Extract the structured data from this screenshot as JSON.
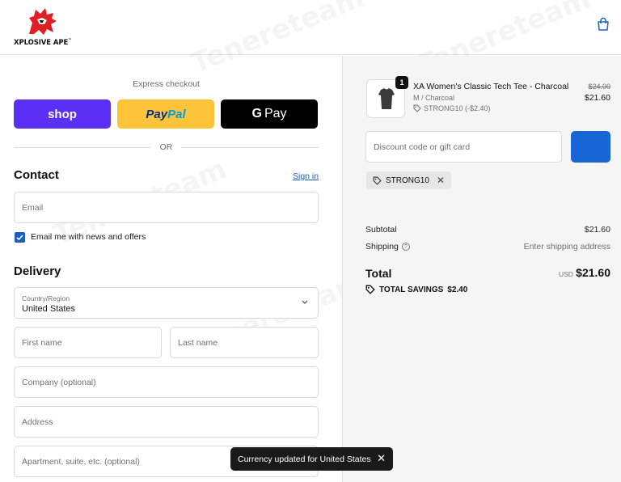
{
  "brand": {
    "name": "XPLOSIVE APE",
    "mark": "™"
  },
  "express": {
    "label": "Express checkout",
    "shop_label": "shop",
    "paypal_part1": "Pay",
    "paypal_part2": "Pal",
    "gpay_g": "G",
    "gpay_label": "Pay"
  },
  "or_label": "OR",
  "contact": {
    "title": "Contact",
    "signin": "Sign in",
    "email_placeholder": "Email",
    "newsletter_label": "Email me with news and offers",
    "newsletter_checked": true
  },
  "delivery": {
    "title": "Delivery",
    "country_label": "Country/Region",
    "country_value": "United States",
    "first_name": "First name",
    "last_name": "Last name",
    "company": "Company (optional)",
    "address": "Address",
    "apartment": "Apartment, suite, etc. (optional)"
  },
  "order": {
    "quantity": "1",
    "product_name": "XA Women's Classic Tech Tee - Charcoal",
    "variant": "M / Charcoal",
    "discount_line": "STRONG10 (-$2.40)",
    "price_old": "$24.00",
    "price_new": "$21.60",
    "discount_placeholder": "Discount code or gift card",
    "applied_code": "STRONG10",
    "subtotal_label": "Subtotal",
    "subtotal_value": "$21.60",
    "shipping_label": "Shipping",
    "shipping_value": "Enter shipping address",
    "total_label": "Total",
    "currency": "USD",
    "total_value": "$21.60",
    "savings_label": "TOTAL SAVINGS",
    "savings_value": "$2.40"
  },
  "toast": {
    "message": "Currency updated for United States"
  },
  "watermark": "Tenereteam",
  "colors": {
    "shop": "#5a31f4",
    "paypal": "#ffc439",
    "gpay": "#000000",
    "link": "#1a5fc2",
    "apply_button": "#1865d6"
  }
}
